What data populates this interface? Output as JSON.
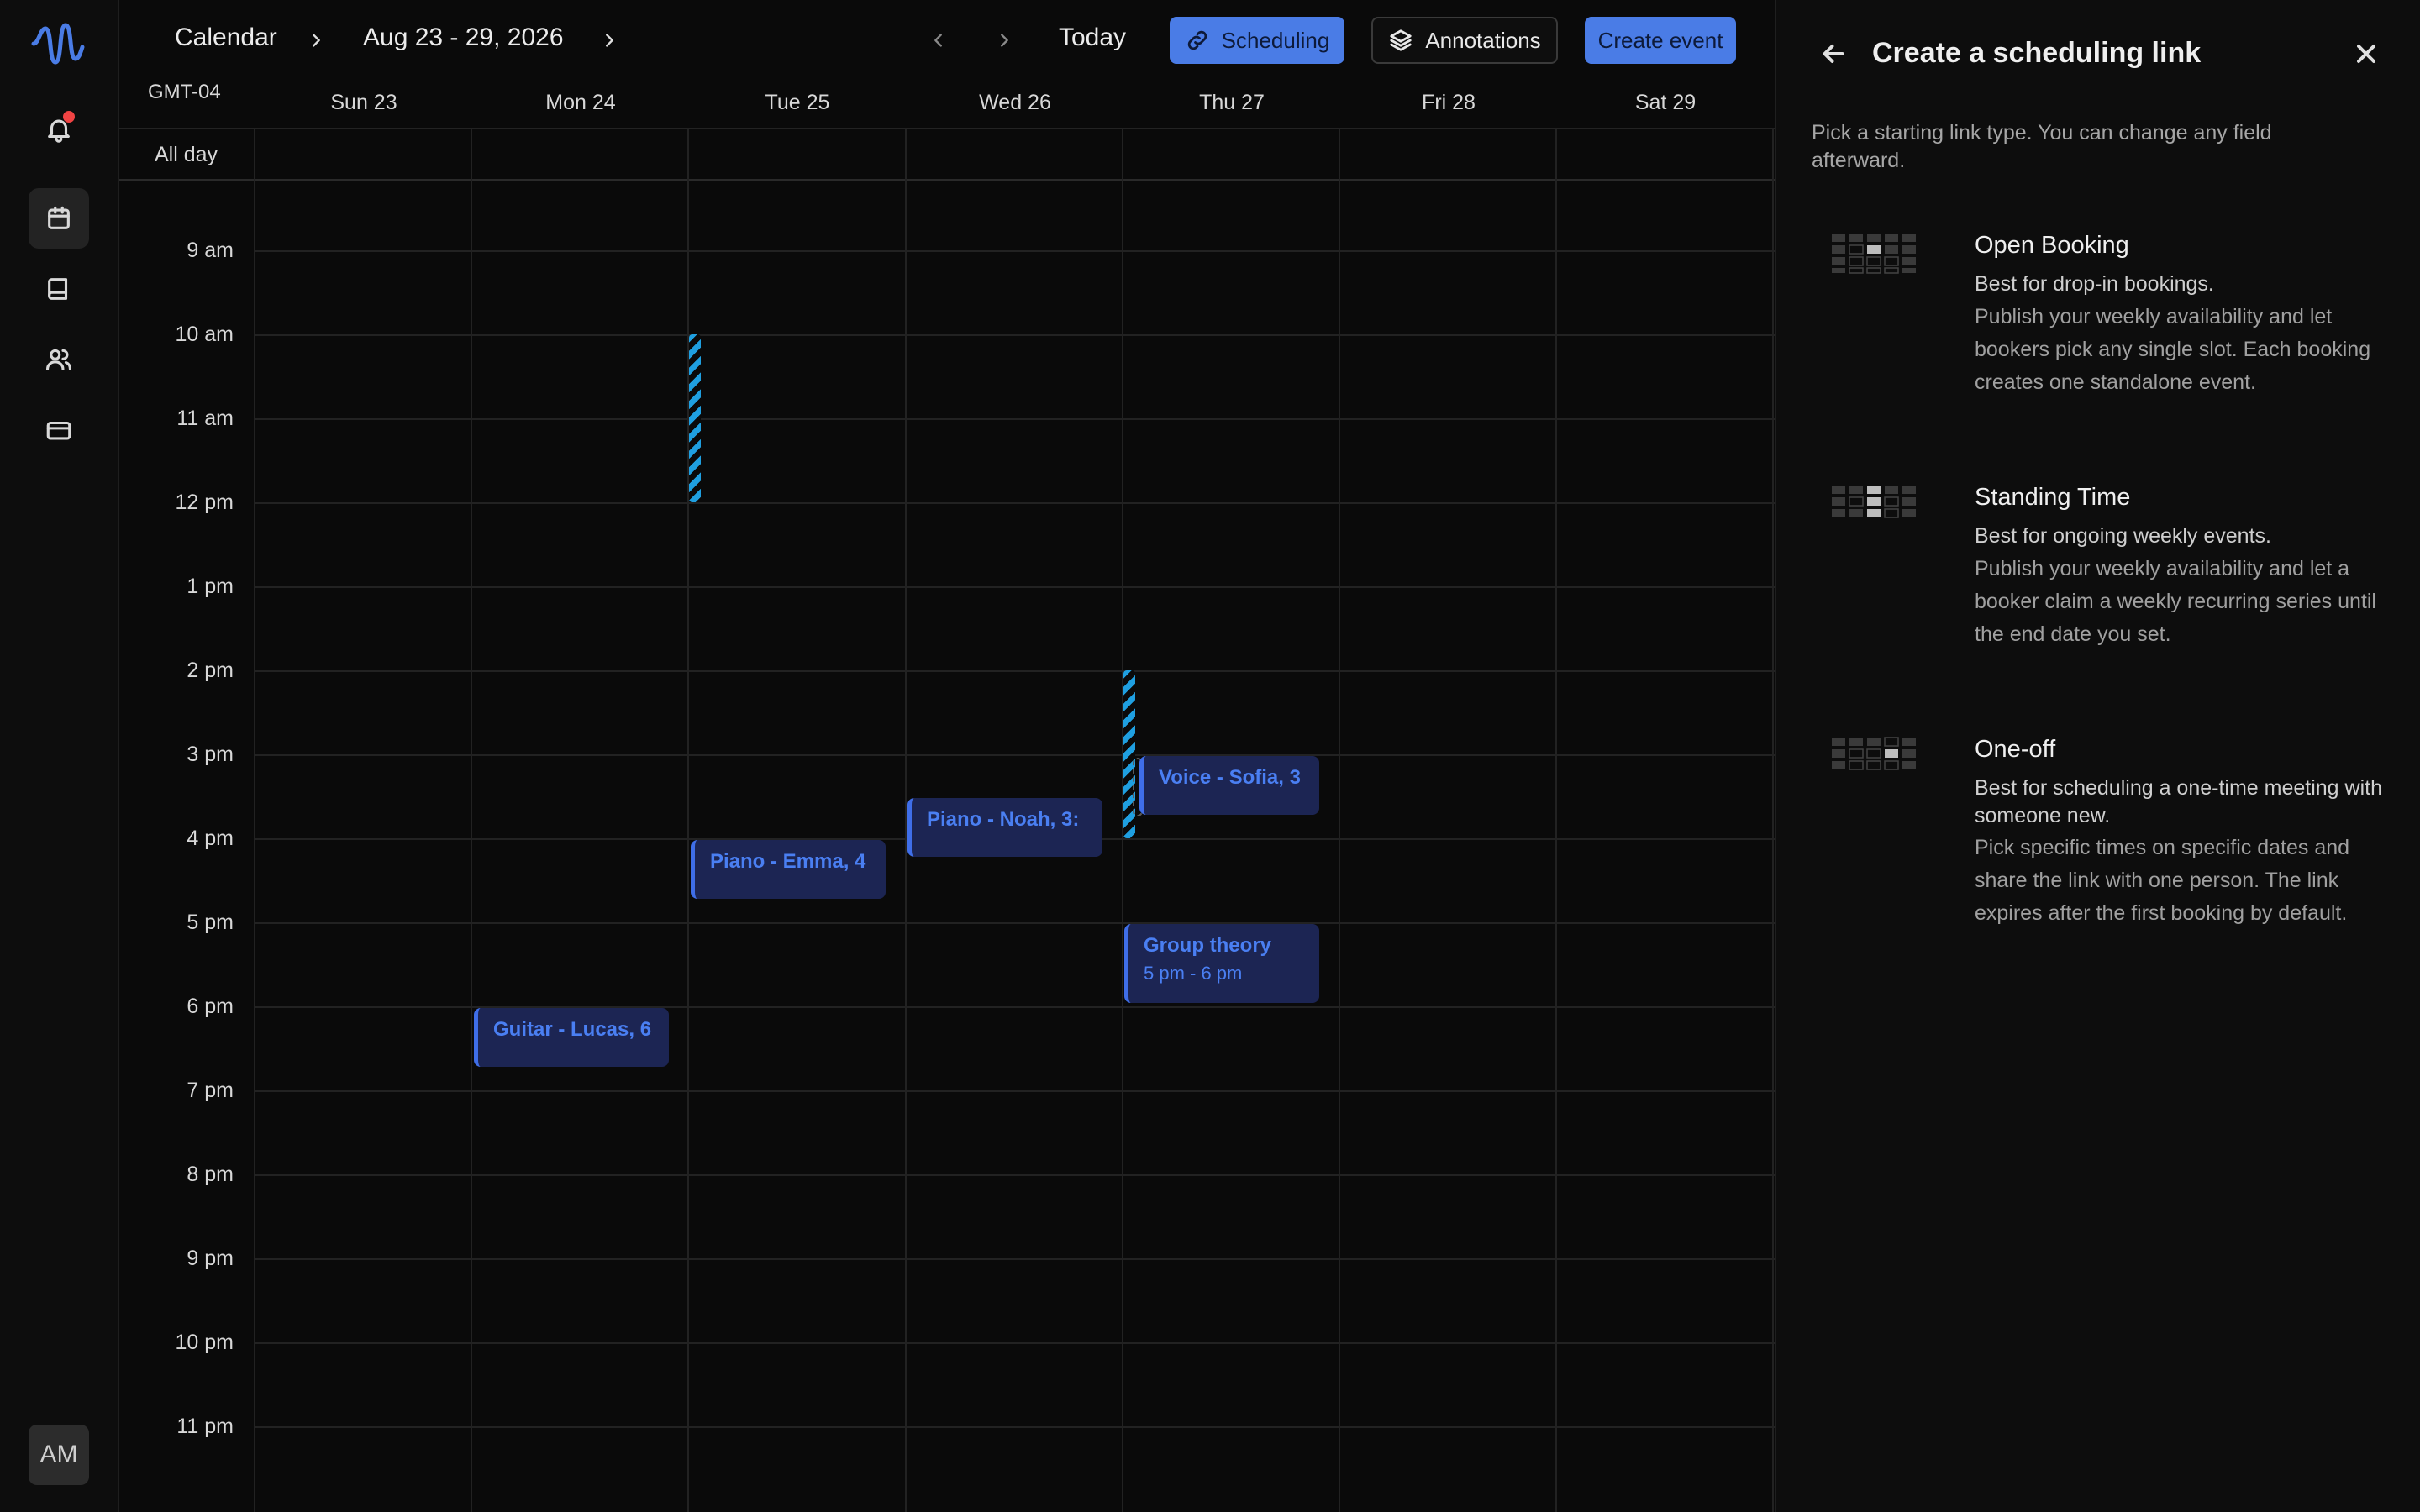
{
  "rail": {
    "avatar_initials": "AM",
    "notification_dot_color": "#f04343",
    "items": [
      {
        "name": "bell-icon"
      },
      {
        "name": "calendar-icon",
        "active": true
      },
      {
        "name": "book-icon"
      },
      {
        "name": "users-icon"
      },
      {
        "name": "credit-card-icon"
      }
    ]
  },
  "header": {
    "title": "Calendar",
    "date_range": "Aug 23 - 29, 2026",
    "today_label": "Today",
    "scheduling_label": "Scheduling",
    "annotations_label": "Annotations",
    "create_event_label": "Create event",
    "accent_color": "#4a7ce6"
  },
  "calendar": {
    "timezone": "GMT-04",
    "all_day_label": "All day",
    "days": [
      "Sun 23",
      "Mon 24",
      "Tue 25",
      "Wed 26",
      "Thu 27",
      "Fri 28",
      "Sat 29"
    ],
    "hours": [
      "9 am",
      "10 am",
      "11 am",
      "12 pm",
      "1 pm",
      "2 pm",
      "3 pm",
      "4 pm",
      "5 pm",
      "6 pm",
      "7 pm",
      "8 pm",
      "9 pm",
      "10 pm",
      "11 pm"
    ],
    "events": [
      {
        "title": "Piano - Emma, 4",
        "day": "Tue 25"
      },
      {
        "title": "Piano - Noah, 3:",
        "day": "Wed 26"
      },
      {
        "title": "Voice - Sofia, 3",
        "day": "Thu 27"
      },
      {
        "title": "Group theory",
        "time": "5 pm - 6 pm",
        "day": "Thu 27"
      },
      {
        "title": "Guitar - Lucas, 6",
        "day": "Mon 24"
      }
    ],
    "event_color": "#3f6ee8",
    "availability_color": "#1f9fe0"
  },
  "panel": {
    "title": "Create a scheduling link",
    "intro": "Pick a starting link type. You can change any field afterward.",
    "options": [
      {
        "name": "Open Booking",
        "best_for": "Best for drop-in bookings.",
        "description": "Publish your weekly availability and let bookers pick any single slot. Each booking creates one standalone event."
      },
      {
        "name": "Standing Time",
        "best_for": "Best for ongoing weekly events.",
        "description": "Publish your weekly availability and let a booker claim a weekly recurring series until the end date you set."
      },
      {
        "name": "One-off",
        "best_for": "Best for scheduling a one-time meeting with someone new.",
        "description": "Pick specific times on specific dates and share the link with one person. The link expires after the first booking by default."
      }
    ]
  }
}
